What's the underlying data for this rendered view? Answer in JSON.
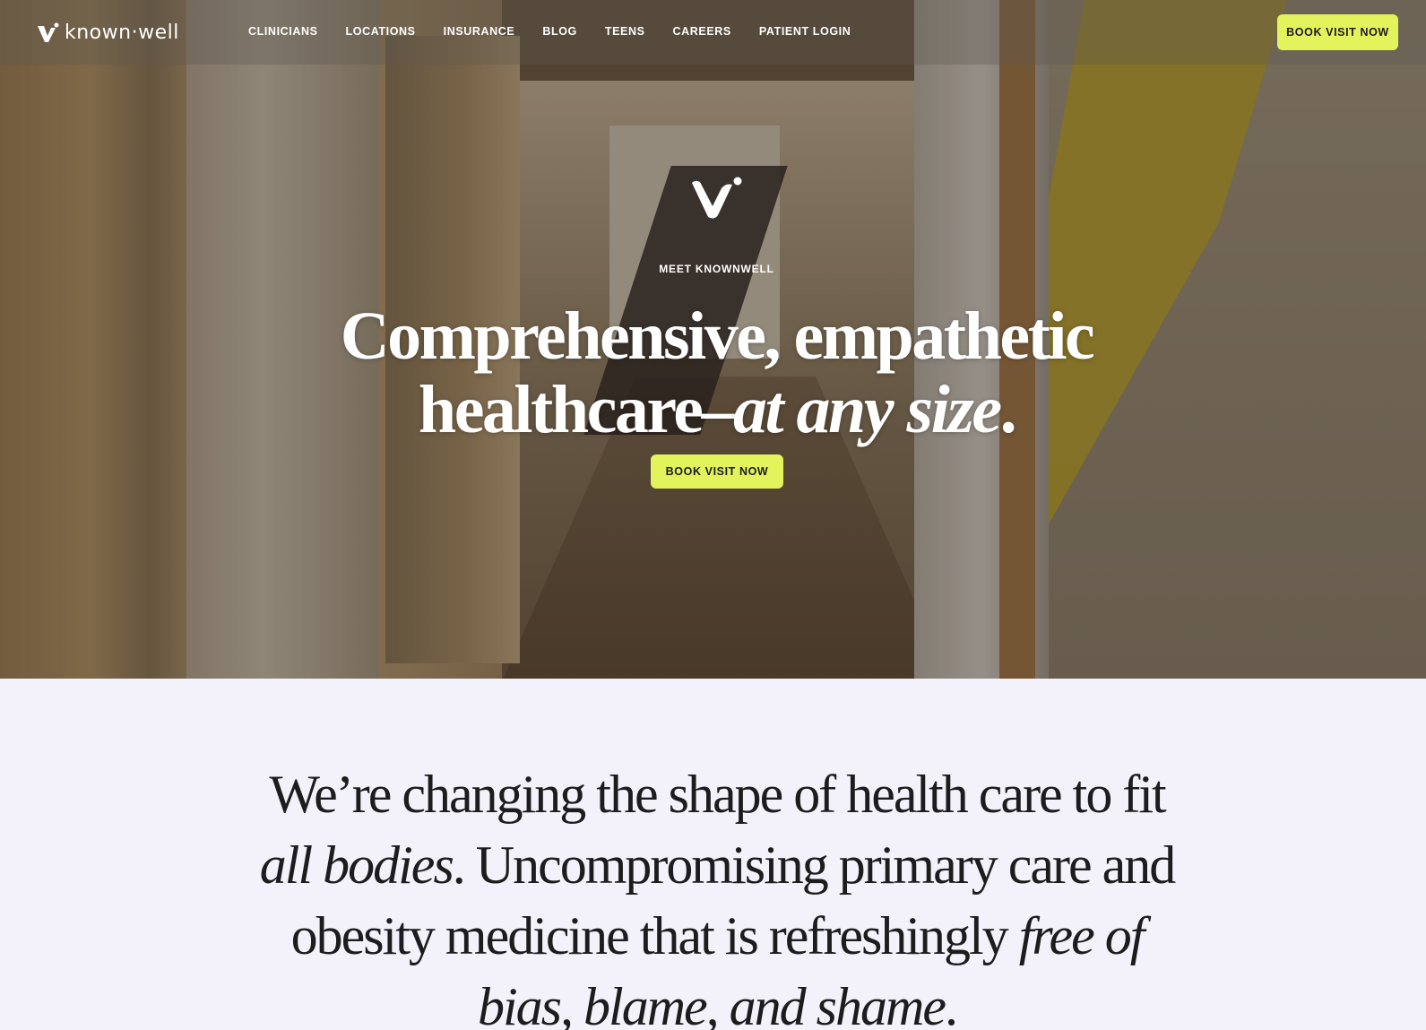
{
  "brand": {
    "logo_text": "known·well",
    "accent_color": "#e3f35c"
  },
  "nav": {
    "links": [
      "CLINICIANS",
      "LOCATIONS",
      "INSURANCE",
      "BLOG",
      "TEENS",
      "CAREERS",
      "PATIENT LOGIN"
    ],
    "cta_label": "BOOK VISIT NOW"
  },
  "hero": {
    "eyebrow": "MEET KNOWNWELL",
    "title_line1": "Comprehensive, empathetic",
    "title_line2_plain": "healthcare–",
    "title_line2_italic": "at any size",
    "title_line2_end": ".",
    "cta_label": "BOOK VISIT NOW"
  },
  "mission": {
    "part1": "We’re changing the shape of health care to fit ",
    "part2_italic": "all bodies",
    "part3": ". Uncompromising primary care and obesity medicine that is refreshingly ",
    "part4_italic": "free of bias, blame, and shame",
    "part5": "."
  }
}
